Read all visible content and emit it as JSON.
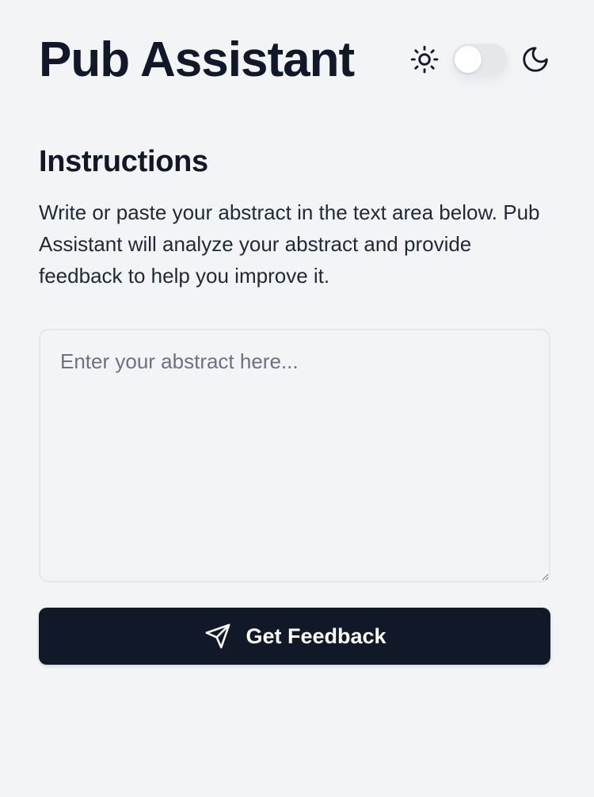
{
  "app": {
    "title": "Pub Assistant"
  },
  "theme_toggle": {
    "light_icon": "sun-icon",
    "dark_icon": "moon-icon",
    "state": "light"
  },
  "instructions": {
    "heading": "Instructions",
    "text": "Write or paste your abstract in the text area below. Pub Assistant will analyze your abstract and provide feedback to help you improve it."
  },
  "abstract_input": {
    "value": "",
    "placeholder": "Enter your abstract here..."
  },
  "submit": {
    "label": "Get Feedback",
    "icon": "send-icon"
  },
  "colors": {
    "background": "#f3f4f6",
    "primary": "#111827",
    "placeholder": "#6b7280",
    "border": "#e5e7eb"
  }
}
